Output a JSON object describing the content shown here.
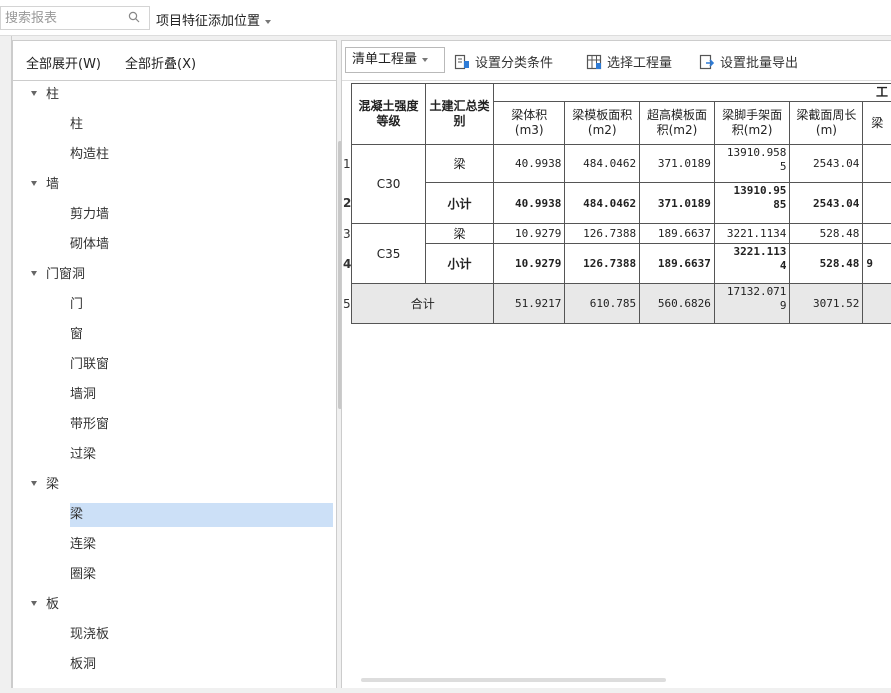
{
  "search": {
    "placeholder": "搜索报表"
  },
  "position_menu": {
    "label": "项目特征添加位置"
  },
  "left": {
    "expand_all": "全部展开(W)",
    "collapse_all": "全部折叠(X)",
    "tree": [
      {
        "label": "柱",
        "type": "group"
      },
      {
        "label": "柱",
        "type": "child"
      },
      {
        "label": "构造柱",
        "type": "child"
      },
      {
        "label": "墙",
        "type": "group"
      },
      {
        "label": "剪力墙",
        "type": "child"
      },
      {
        "label": "砌体墙",
        "type": "child"
      },
      {
        "label": "门窗洞",
        "type": "group"
      },
      {
        "label": "门",
        "type": "child"
      },
      {
        "label": "窗",
        "type": "child"
      },
      {
        "label": "门联窗",
        "type": "child"
      },
      {
        "label": "墙洞",
        "type": "child"
      },
      {
        "label": "带形窗",
        "type": "child"
      },
      {
        "label": "过梁",
        "type": "child"
      },
      {
        "label": "梁",
        "type": "group"
      },
      {
        "label": "梁",
        "type": "child",
        "selected": true
      },
      {
        "label": "连梁",
        "type": "child"
      },
      {
        "label": "圈梁",
        "type": "child"
      },
      {
        "label": "板",
        "type": "group"
      },
      {
        "label": "现浇板",
        "type": "child"
      },
      {
        "label": "板洞",
        "type": "child"
      }
    ]
  },
  "toolbar": {
    "qty_select": "清单工程量",
    "set_category": "设置分类条件",
    "select_qty": "选择工程量",
    "set_batch_export": "设置批量导出"
  },
  "table": {
    "top_header": "工",
    "headers": {
      "grade": "混凝土强度等级",
      "category": "土建汇总类别",
      "c1": "梁体积(m3)",
      "c2": "梁模板面积(m2)",
      "c3": "超高模板面积(m2)",
      "c4": "梁脚手架面积(m2)",
      "c5": "梁截面周长(m)",
      "c6": "梁"
    },
    "rows": [
      {
        "n": "1",
        "cat": "梁",
        "v1": "40.9938",
        "v2": "484.0462",
        "v3": "371.0189",
        "v4": "13910.958\n5",
        "v5": "2543.04"
      },
      {
        "n": "2",
        "cat": "小计",
        "v1": "40.9938",
        "v2": "484.0462",
        "v3": "371.0189",
        "v4": "13910.95\n85",
        "v5": "2543.04"
      },
      {
        "n": "3",
        "cat": "梁",
        "v1": "10.9279",
        "v2": "126.7388",
        "v3": "189.6637",
        "v4": "3221.1134",
        "v5": "528.48"
      },
      {
        "n": "4",
        "cat": "小计",
        "v1": "10.9279",
        "v2": "126.7388",
        "v3": "189.6637",
        "v4": "3221.113\n4",
        "v5": "528.48",
        "v6": "9"
      }
    ],
    "groups": [
      "C30",
      "C35"
    ],
    "total": {
      "n": "5",
      "label": "合计",
      "v1": "51.9217",
      "v2": "610.785",
      "v3": "560.6826",
      "v4": "17132.071\n9",
      "v5": "3071.52"
    }
  }
}
